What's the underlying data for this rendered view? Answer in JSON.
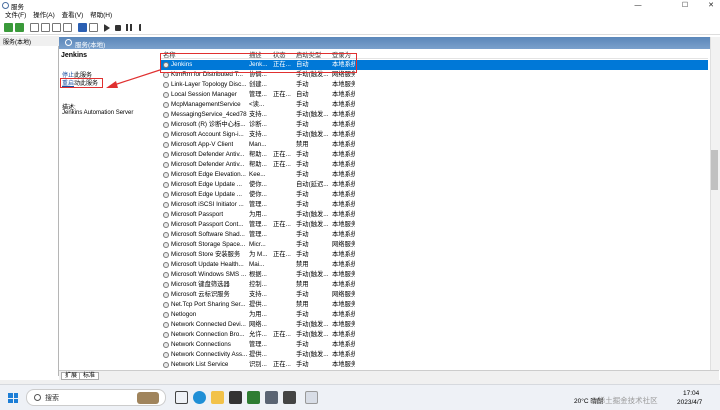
{
  "window": {
    "title": "服务"
  },
  "menu": [
    "文件(F)",
    "操作(A)",
    "查看(V)",
    "帮助(H)"
  ],
  "tree": {
    "header": "服务(本地)"
  },
  "pane": {
    "header": "服务(本地)"
  },
  "desc": {
    "name": "Jenkins",
    "stop_prefix": "停止",
    "stop_suffix": "此服务",
    "restart_prefix": "重启",
    "restart_suffix": "动此服务",
    "desc_label": "描述:",
    "desc_text": "Jenkins Automation Server"
  },
  "columns": [
    "名称",
    "描述",
    "状态",
    "启动类型",
    "登录为"
  ],
  "rows": [
    [
      "Jenkins",
      "Jenk...",
      "正在...",
      "自动",
      "本地系统"
    ],
    [
      "KtmRm for Distributed T...",
      "协调...",
      "",
      "手动(触发...",
      "网络服务"
    ],
    [
      "Link-Layer Topology Disc...",
      "创建...",
      "",
      "手动",
      "本地服务"
    ],
    [
      "Local Session Manager",
      "管理...",
      "正在...",
      "自动",
      "本地系统"
    ],
    [
      "McpManagementService",
      "<读...",
      "",
      "手动",
      "本地系统"
    ],
    [
      "MessagingService_4ced78",
      "支持...",
      "",
      "手动(触发...",
      "本地系统"
    ],
    [
      "Microsoft (R) 诊断中心标...",
      "诊断...",
      "",
      "手动",
      "本地系统"
    ],
    [
      "Microsoft Account Sign-i...",
      "支持...",
      "",
      "手动(触发...",
      "本地系统"
    ],
    [
      "Microsoft App-V Client",
      "Man...",
      "",
      "禁用",
      "本地系统"
    ],
    [
      "Microsoft Defender Antiv...",
      "帮助...",
      "正在...",
      "手动",
      "本地系统"
    ],
    [
      "Microsoft Defender Antiv...",
      "帮助...",
      "正在...",
      "手动",
      "本地系统"
    ],
    [
      "Microsoft Edge Elevation...",
      "Kee...",
      "",
      "手动",
      "本地系统"
    ],
    [
      "Microsoft Edge Update ...",
      "使你...",
      "",
      "自动(延迟...",
      "本地系统"
    ],
    [
      "Microsoft Edge Update ...",
      "使你...",
      "",
      "手动",
      "本地系统"
    ],
    [
      "Microsoft iSCSI Initiator ...",
      "管理...",
      "",
      "手动",
      "本地系统"
    ],
    [
      "Microsoft Passport",
      "为用...",
      "",
      "手动(触发...",
      "本地系统"
    ],
    [
      "Microsoft Passport Cont...",
      "管理...",
      "正在...",
      "手动(触发...",
      "本地服务"
    ],
    [
      "Microsoft Software Shad...",
      "管理...",
      "",
      "手动",
      "本地系统"
    ],
    [
      "Microsoft Storage Space...",
      "Micr...",
      "",
      "手动",
      "网络服务"
    ],
    [
      "Microsoft Store 安装服务",
      "为 M...",
      "正在...",
      "手动",
      "本地系统"
    ],
    [
      "Microsoft Update Health...",
      "Mai...",
      "",
      "禁用",
      "本地系统"
    ],
    [
      "Microsoft Windows SMS ...",
      "根据...",
      "",
      "手动(触发...",
      "本地服务"
    ],
    [
      "Microsoft 键盘筛选器",
      "控制...",
      "",
      "禁用",
      "本地系统"
    ],
    [
      "Microsoft 云标识服务",
      "支持...",
      "",
      "手动",
      "网络服务"
    ],
    [
      "Net.Tcp Port Sharing Ser...",
      "提供...",
      "",
      "禁用",
      "本地服务"
    ],
    [
      "Netlogon",
      "为用...",
      "",
      "手动",
      "本地系统"
    ],
    [
      "Network Connected Devi...",
      "网络...",
      "",
      "手动(触发...",
      "本地服务"
    ],
    [
      "Network Connection Bro...",
      "允许...",
      "正在...",
      "手动(触发...",
      "本地系统"
    ],
    [
      "Network Connections",
      "管理...",
      "",
      "手动",
      "本地系统"
    ],
    [
      "Network Connectivity Ass...",
      "提供...",
      "",
      "手动(触发...",
      "本地系统"
    ],
    [
      "Network List Service",
      "识别...",
      "正在...",
      "手动",
      "本地服务"
    ]
  ],
  "tabs": [
    "扩展",
    "标准"
  ],
  "taskbar": {
    "search_placeholder": "搜索",
    "temp": "20°C 晴朗",
    "time": "17:04",
    "date": "2023/4/7",
    "watermark": "@稀土掘金技术社区"
  },
  "colors": {
    "selection": "#0078d7",
    "highlight": "#e03030",
    "header": "#6a94c4"
  }
}
